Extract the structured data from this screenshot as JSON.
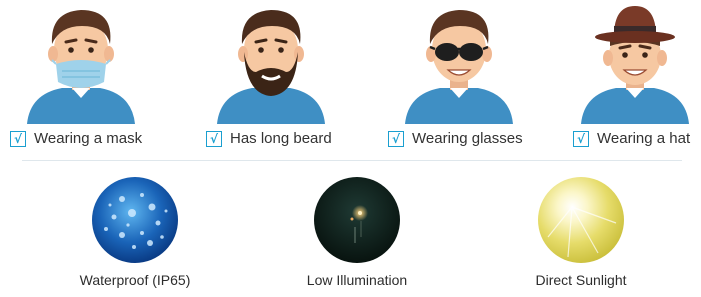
{
  "colors": {
    "accent": "#1a9fd0",
    "shirt": "#3f8fc4",
    "skin": "#f6c8a2",
    "hair": "#5a3522"
  },
  "features": [
    {
      "check": "√",
      "label": "Wearing a mask"
    },
    {
      "check": "√",
      "label": "Has long beard"
    },
    {
      "check": "√",
      "label": "Wearing glasses"
    },
    {
      "check": "√",
      "label": "Wearing a hat"
    }
  ],
  "environments": [
    {
      "label": "Waterproof (IP65)",
      "icon": "water-drops-icon"
    },
    {
      "label": "Low Illumination",
      "icon": "night-light-icon"
    },
    {
      "label": "Direct Sunlight",
      "icon": "sun-icon"
    }
  ]
}
